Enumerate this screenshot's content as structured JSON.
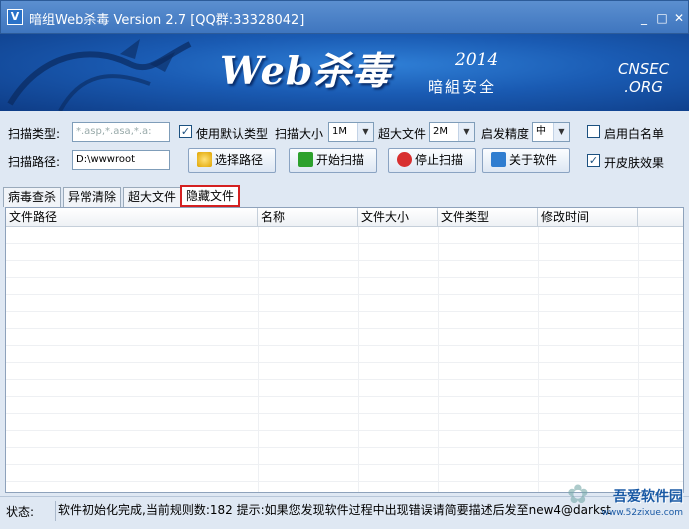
{
  "window": {
    "icon_letter": "V",
    "title": "暗组Web杀毒   Version 2.7   [QQ群:33328042]",
    "minimize": "_",
    "maximize": "□",
    "close": "✕"
  },
  "banner": {
    "logo": "Web杀毒",
    "year": "2014",
    "subtitle": "暗組安全",
    "cnsec_line1": "CNSEC",
    "cnsec_line2": ".ORG",
    "accent": "#1a5bb3"
  },
  "controls": {
    "scan_type_label": "扫描类型:",
    "scan_type_value": "*.asp,*.asa,*.a:",
    "use_default_label": "使用默认类型",
    "use_default_checked": true,
    "scan_size_label": "扫描大小",
    "scan_size_value": "1M",
    "large_file_label": "超大文件",
    "large_file_value": "2M",
    "heuristic_label": "启发精度",
    "heuristic_value": "中",
    "whitelist_label": "启用白名单",
    "whitelist_checked": false,
    "scan_path_label": "扫描路径:",
    "scan_path_value": "D:\\wwwroot",
    "select_path_button": "选择路径",
    "start_scan_button": "开始扫描",
    "stop_scan_button": "停止扫描",
    "about_button": "关于软件",
    "skin_label": "开皮肤效果",
    "skin_checked": true
  },
  "tabs": [
    {
      "label": "病毒查杀",
      "active": false
    },
    {
      "label": "异常清除",
      "active": false
    },
    {
      "label": "超大文件",
      "active": false
    },
    {
      "label": "隐藏文件",
      "active": true
    }
  ],
  "table": {
    "columns": [
      "文件路径",
      "名称",
      "文件大小",
      "文件类型",
      "修改时间"
    ],
    "rows": []
  },
  "status": {
    "label": "状态:",
    "text": "软件初始化完成,当前规则数:182 提示:如果您发现软件过程中出现错误请简要描述后发至new4@darkst"
  },
  "watermark": {
    "name": "吾爱软件园",
    "url": "www.52zixue.com"
  }
}
